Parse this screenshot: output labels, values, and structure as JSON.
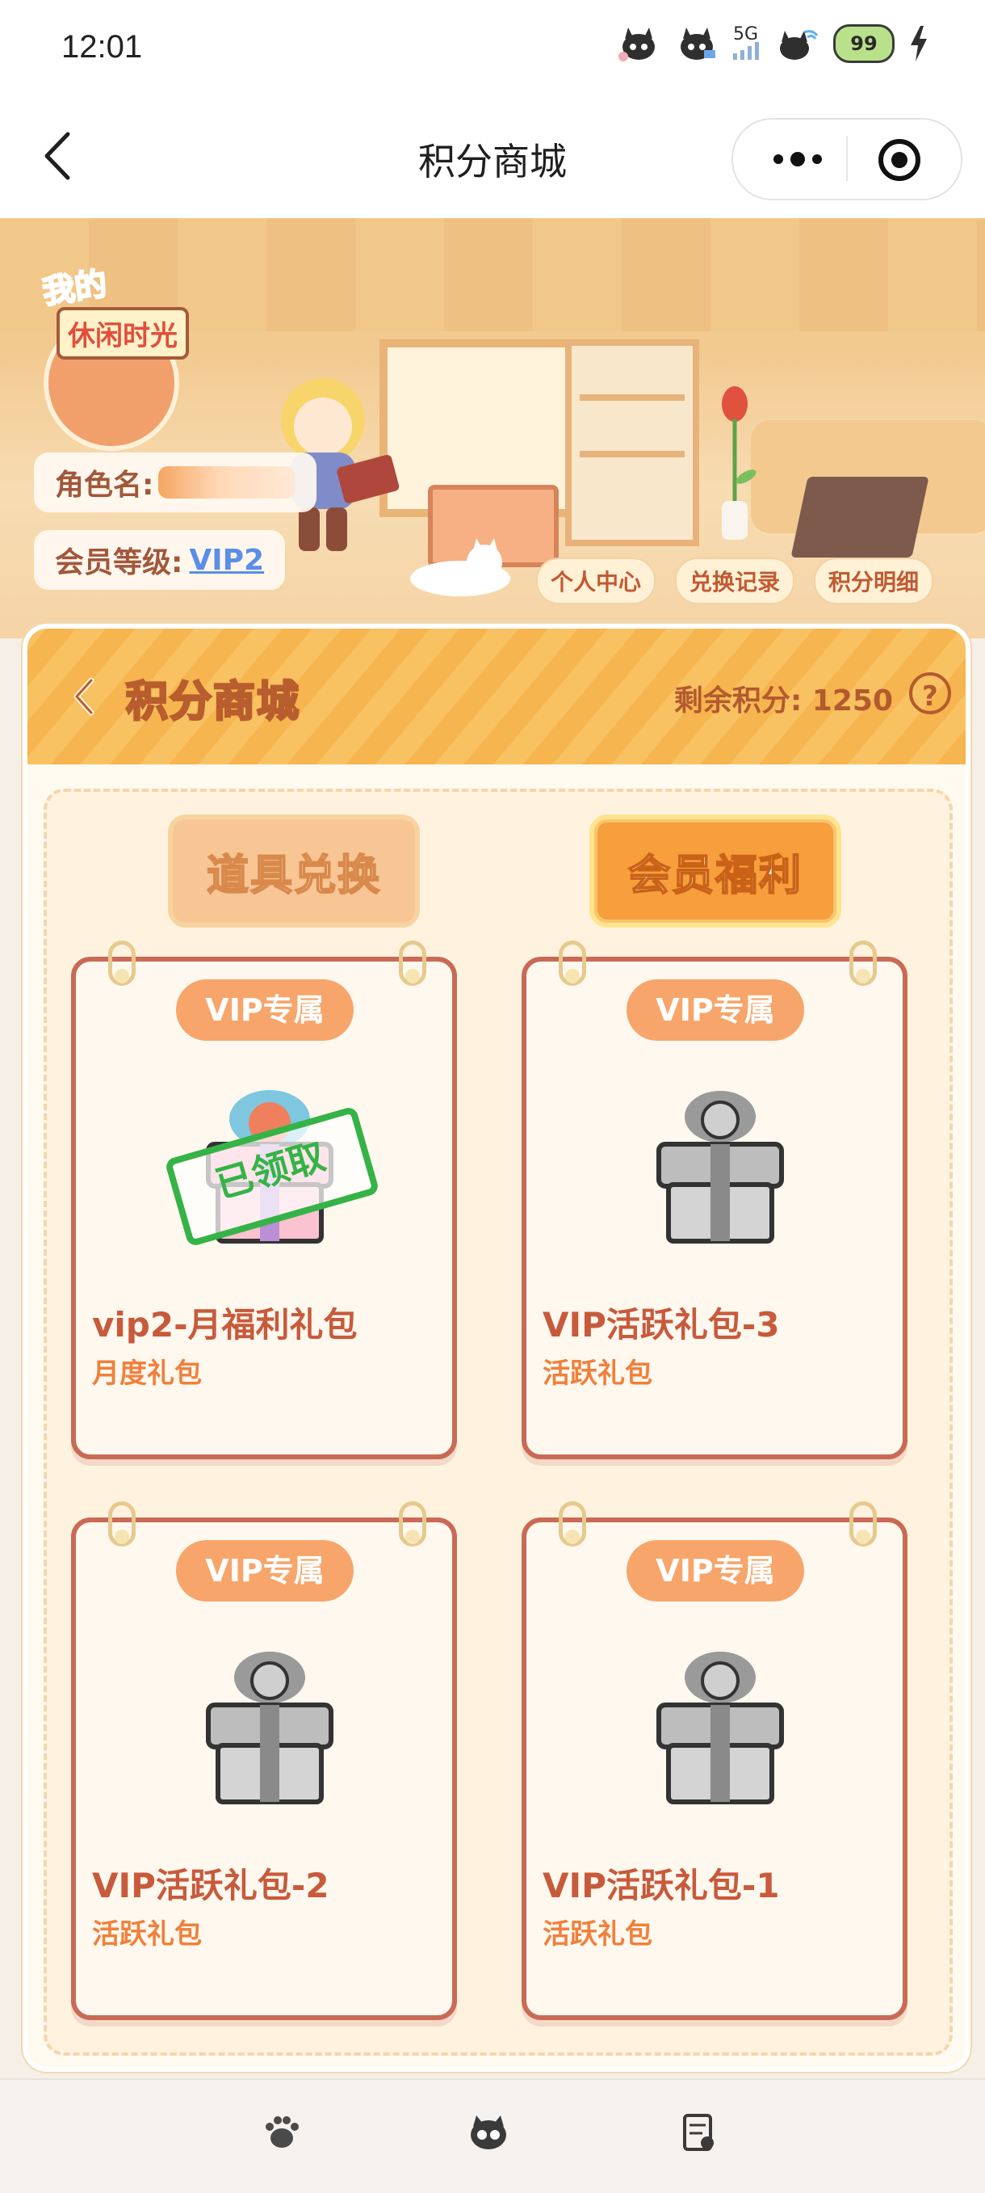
{
  "status_bar": {
    "time": "12:01",
    "network": "5G",
    "battery_level": "99"
  },
  "nav": {
    "title": "积分商城",
    "more_icon": "more-dots-icon",
    "close_icon": "target-icon"
  },
  "banner": {
    "logo_line1": "我的",
    "logo_line2": "休闲时光",
    "role_label": "角色名:",
    "member_label": "会员等级:",
    "member_level": "VIP2",
    "links": [
      "个人中心",
      "兑换记录",
      "积分明细"
    ]
  },
  "panel": {
    "title": "积分商城",
    "points_label": "剩余积分:",
    "points_value": "1250",
    "help": "?",
    "tabs": [
      {
        "label": "道具兑换",
        "active": false
      },
      {
        "label": "会员福利",
        "active": true
      }
    ],
    "items": [
      {
        "badge": "VIP专属",
        "name": "vip2-月福利礼包",
        "type": "月度礼包",
        "claimed": true,
        "stamp": "已领取"
      },
      {
        "badge": "VIP专属",
        "name": "VIP活跃礼包-3",
        "type": "活跃礼包",
        "claimed": false
      },
      {
        "badge": "VIP专属",
        "name": "VIP活跃礼包-2",
        "type": "活跃礼包",
        "claimed": false
      },
      {
        "badge": "VIP专属",
        "name": "VIP活跃礼包-1",
        "type": "活跃礼包",
        "claimed": false
      }
    ]
  },
  "tabbar": {
    "icons": [
      "paw-icon",
      "cat-face-icon",
      "note-icon"
    ]
  },
  "colors": {
    "accent": "#f79e3d",
    "card_border": "#c96a56",
    "title_text": "#c85a3c",
    "stamp_green": "#35b346",
    "vip_blue": "#5b8ee6"
  }
}
